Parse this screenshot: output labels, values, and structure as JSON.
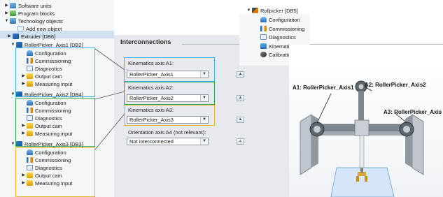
{
  "tree": {
    "items": [
      {
        "label": "Software units",
        "icon": "folder-icon",
        "expand": "▶"
      },
      {
        "label": "Program blocks",
        "icon": "program-blocks-icon",
        "expand": "▶"
      },
      {
        "label": "Technology objects",
        "icon": "technology-objects-icon",
        "expand": "▼"
      },
      {
        "label": "Add new object",
        "icon": "add-object-icon",
        "expand": ""
      },
      {
        "label": "Extruder [DB6]",
        "icon": "axis-icon",
        "expand": "▶"
      },
      {
        "label": "RollerPicker_Axis1 [DB2]",
        "icon": "axis-icon",
        "expand": "▼"
      },
      {
        "label": "Configuration",
        "icon": "configuration-icon",
        "expand": ""
      },
      {
        "label": "Commissioning",
        "icon": "commissioning-icon",
        "expand": ""
      },
      {
        "label": "Diagnostics",
        "icon": "diagnostics-icon",
        "expand": ""
      },
      {
        "label": "Output cam",
        "icon": "output-cam-icon",
        "expand": "▶"
      },
      {
        "label": "Measuring input",
        "icon": "measuring-input-icon",
        "expand": "▶"
      },
      {
        "label": "RollerPicker_Axis2 [DB4]",
        "icon": "axis-icon",
        "expand": "▼"
      },
      {
        "label": "Configuration",
        "icon": "configuration-icon",
        "expand": ""
      },
      {
        "label": "Commissioning",
        "icon": "commissioning-icon",
        "expand": ""
      },
      {
        "label": "Diagnostics",
        "icon": "diagnostics-icon",
        "expand": ""
      },
      {
        "label": "Output cam",
        "icon": "output-cam-icon",
        "expand": "▶"
      },
      {
        "label": "Measuring input",
        "icon": "measuring-input-icon",
        "expand": "▶"
      },
      {
        "label": "RollerPicker_Axis3 [DB3]",
        "icon": "axis-icon",
        "expand": "▼"
      },
      {
        "label": "Configuration",
        "icon": "configuration-icon",
        "expand": ""
      },
      {
        "label": "Commissioning",
        "icon": "commissioning-icon",
        "expand": ""
      },
      {
        "label": "Diagnostics",
        "icon": "diagnostics-icon",
        "expand": ""
      },
      {
        "label": "Output cam",
        "icon": "output-cam-icon",
        "expand": "▶"
      },
      {
        "label": "Measuring input",
        "icon": "measuring-input-icon",
        "expand": "▶"
      }
    ]
  },
  "rollpicker_menu": {
    "title": "Rollpicker [DB5]",
    "expand": "▼",
    "items": [
      {
        "label": "Configuration",
        "icon": "configuration-icon"
      },
      {
        "label": "Commissioning",
        "icon": "commissioning-icon"
      },
      {
        "label": "Diagnostics",
        "icon": "diagnostics-icon"
      },
      {
        "label": "Kinematics trace",
        "icon": "kinematics-trace-icon"
      },
      {
        "label": "Calibration",
        "icon": "calibration-icon"
      }
    ]
  },
  "interconnections": {
    "title": "Interconnections",
    "axes": [
      {
        "label": "Kinematics axis A1:",
        "value": "RollerPicker_Axis1",
        "color": "#39b6ea"
      },
      {
        "label": "Kinematics axis A2:",
        "value": "RollerPicker_Axis2",
        "color": "#2fa84f"
      },
      {
        "label": "Kinematics axis A3:",
        "value": "RollerPicker_Axis3",
        "color": "#f2b233"
      },
      {
        "label": "Orientation axis A4 (not relevant):",
        "value": "Not interconnected",
        "color": ""
      }
    ],
    "dropdown_arrow": "▼"
  },
  "scene": {
    "labels": {
      "a1": "A1: RollerPicker_Axis1",
      "a2": "A2: RollerPicker_Axis2",
      "a3": "A3: RollerPicker_Axis"
    }
  },
  "colors": {
    "axis1_frame": "#39b6ea",
    "axis2_frame": "#2fa84f",
    "axis3_frame": "#f2b233",
    "selection": "#cfe0f0"
  }
}
